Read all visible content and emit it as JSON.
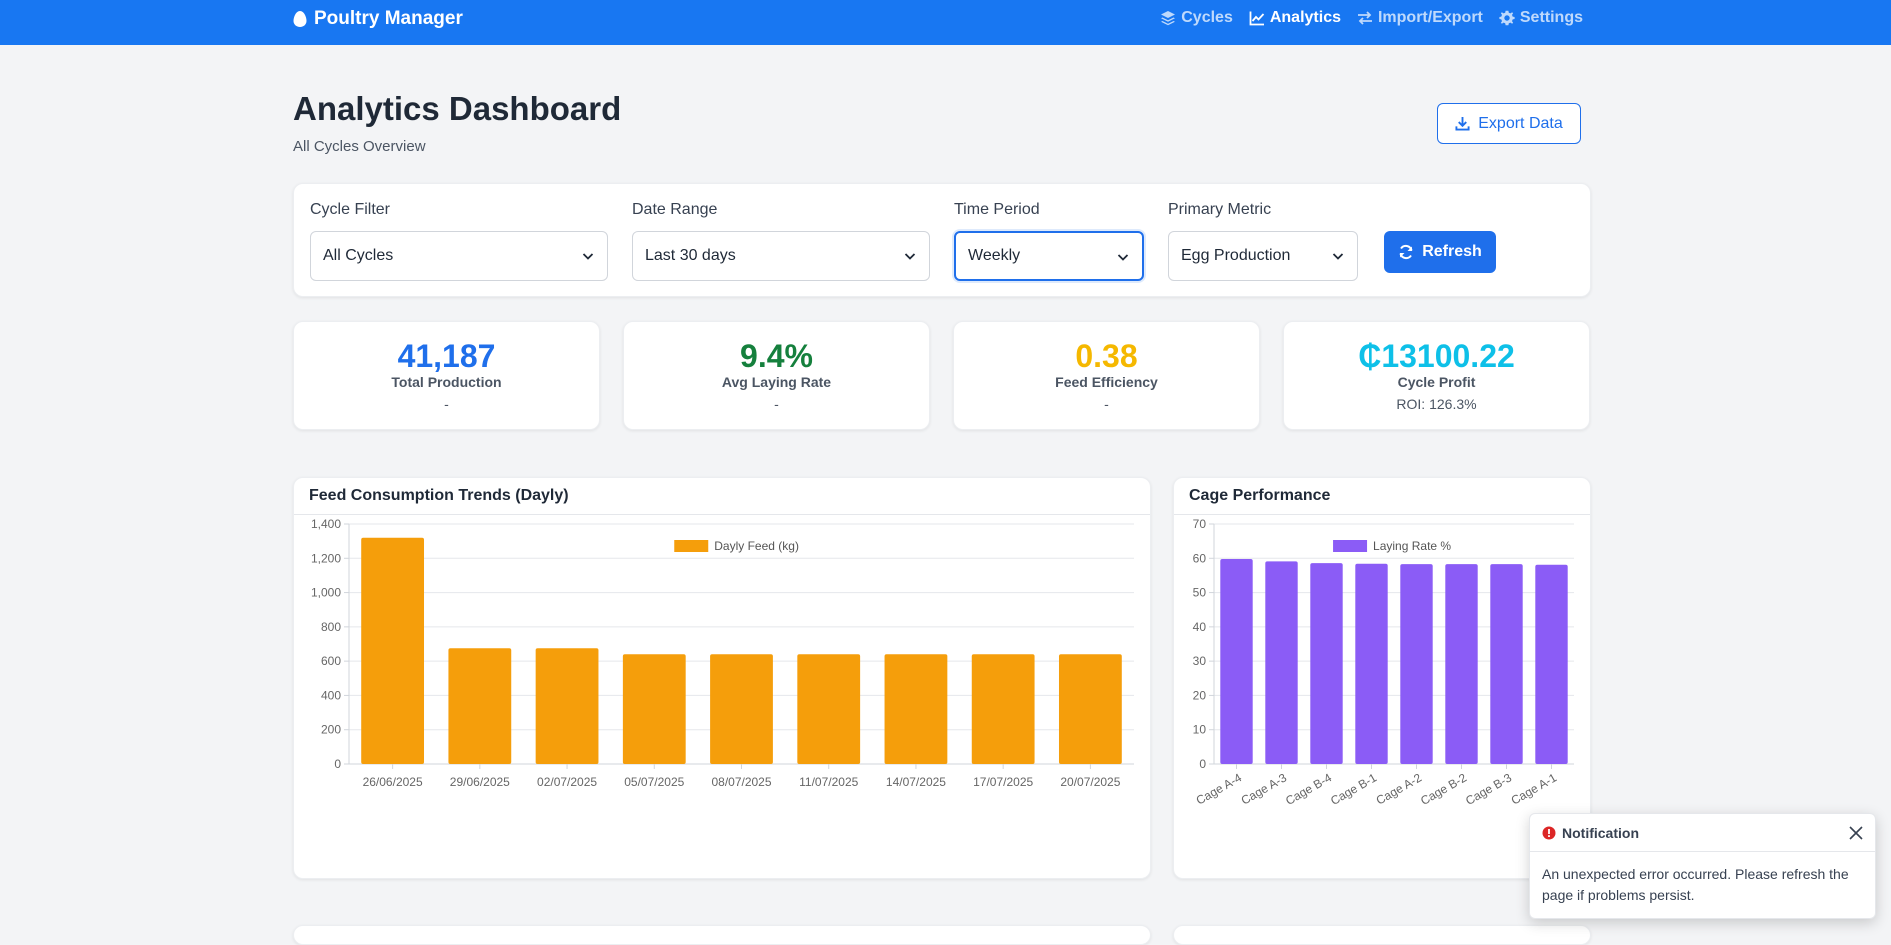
{
  "app": {
    "name": "Poultry Manager"
  },
  "nav": {
    "items": [
      {
        "label": "Cycles",
        "icon": "layers-icon"
      },
      {
        "label": "Analytics",
        "icon": "chart-line-icon",
        "active": true
      },
      {
        "label": "Import/Export",
        "icon": "swap-arrows-icon"
      },
      {
        "label": "Settings",
        "icon": "gear-icon"
      }
    ]
  },
  "header": {
    "title": "Analytics Dashboard",
    "subtitle": "All Cycles Overview",
    "export_label": "Export Data"
  },
  "filters": {
    "cycle": {
      "label": "Cycle Filter",
      "value": "All Cycles"
    },
    "date_range": {
      "label": "Date Range",
      "value": "Last 30 days"
    },
    "time_period": {
      "label": "Time Period",
      "value": "Weekly"
    },
    "metric": {
      "label": "Primary Metric",
      "value": "Egg Production"
    },
    "refresh_label": "Refresh"
  },
  "stats": [
    {
      "value": "41,187",
      "label": "Total Production",
      "sub": "-",
      "color": "#1f6feb"
    },
    {
      "value": "9.4%",
      "label": "Avg Laying Rate",
      "sub": "-",
      "color": "#15803d"
    },
    {
      "value": "0.38",
      "label": "Feed Efficiency",
      "sub": "-",
      "color": "#f5b800"
    },
    {
      "value": "₵13100.22",
      "label": "Cycle Profit",
      "sub": "ROI: 126.3%",
      "color": "#0ec0e8"
    }
  ],
  "panels": {
    "feed_title": "Feed Consumption Trends (Dayly)",
    "cage_title": "Cage Performance"
  },
  "chart_data": [
    {
      "type": "bar",
      "categories": [
        "26/06/2025",
        "29/06/2025",
        "02/07/2025",
        "05/07/2025",
        "08/07/2025",
        "11/07/2025",
        "14/07/2025",
        "17/07/2025",
        "20/07/2025"
      ],
      "series": [
        {
          "name": "Dayly Feed (kg)",
          "values": [
            1320,
            675,
            675,
            640,
            640,
            640,
            640,
            640,
            640
          ],
          "color": "#f59e0b"
        }
      ],
      "ylim": [
        0,
        1400
      ],
      "yticks": [
        "0",
        "200",
        "400",
        "600",
        "800",
        "1,000",
        "1,200",
        "1,400"
      ],
      "grid": true,
      "legend": "top-center"
    },
    {
      "type": "bar",
      "categories": [
        "Cage A-4",
        "Cage A-3",
        "Cage B-4",
        "Cage B-1",
        "Cage A-2",
        "Cage B-2",
        "Cage B-3",
        "Cage A-1"
      ],
      "series": [
        {
          "name": "Laying Rate %",
          "values": [
            59.8,
            59.1,
            58.6,
            58.4,
            58.3,
            58.3,
            58.3,
            58.1
          ],
          "color": "#8b5cf6"
        }
      ],
      "ylim": [
        0,
        70
      ],
      "yticks": [
        "0",
        "10",
        "20",
        "30",
        "40",
        "50",
        "60",
        "70"
      ],
      "grid": true,
      "legend": "top-center"
    }
  ],
  "toast": {
    "title": "Notification",
    "message": "An unexpected error occurred. Please refresh the page if problems persist."
  }
}
